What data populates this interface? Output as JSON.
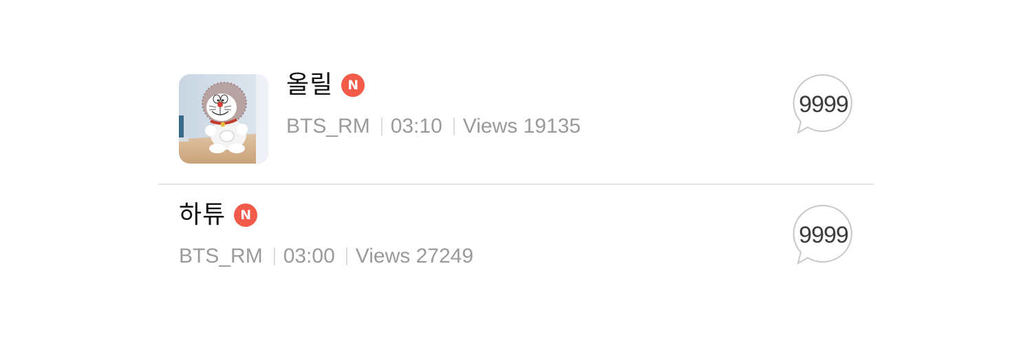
{
  "posts": [
    {
      "title": "올릴",
      "new_badge": "N",
      "author": "BTS_RM",
      "duration": "03:10",
      "views": "Views 19135",
      "comment_count": "9999",
      "has_thumbnail": true
    },
    {
      "title": "하튜",
      "new_badge": "N",
      "author": "BTS_RM",
      "duration": "03:00",
      "views": "Views 27249",
      "comment_count": "9999",
      "has_thumbnail": false
    }
  ],
  "colors": {
    "badge": "#f25a4a",
    "meta_text": "#9a9a9a",
    "divider": "#e2e2e2",
    "bubble_border": "#c8c8c8"
  }
}
